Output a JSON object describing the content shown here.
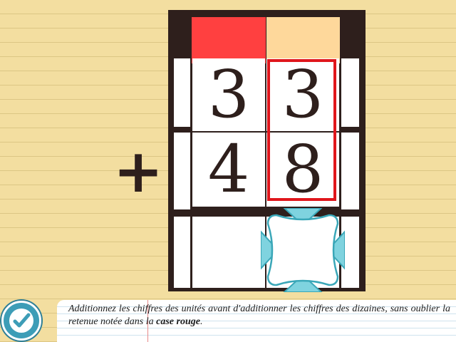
{
  "colors": {
    "background": "#f3dea0",
    "board": "#2e1f1c",
    "tens_header": "#ff4040",
    "units_header": "#fed89b",
    "highlight_border": "#e0161c",
    "answer_slot": "#3aa7b8",
    "check_button": "#3d9db7"
  },
  "operation": {
    "operator": "+",
    "top_number": {
      "tens": "3",
      "units": "3"
    },
    "bottom_number": {
      "tens": "4",
      "units": "8"
    },
    "result": {
      "tens": "",
      "units": ""
    }
  },
  "instruction": {
    "text_before": "Additionnez les chiffres des unités avant d'additionner les chiffres des dizaines, sans oublier la retenue notée dans la ",
    "emphasis": "case rouge",
    "text_after": "."
  },
  "icons": {
    "check_button": "checkmark-icon",
    "answer_slot": "drop-target-icon"
  }
}
